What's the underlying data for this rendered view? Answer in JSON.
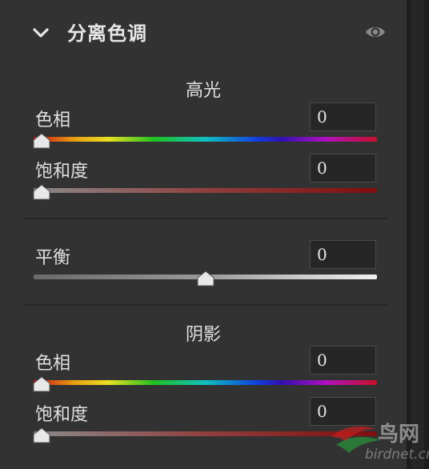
{
  "panel": {
    "title": "分离色调",
    "icons": {
      "collapse": "chevron-down-icon",
      "visibility": "eye-icon"
    }
  },
  "highlights": {
    "label": "高光",
    "hue": {
      "label": "色相",
      "value": "0",
      "slider_fraction": 0.0
    },
    "saturation": {
      "label": "饱和度",
      "value": "0",
      "slider_fraction": 0.0
    }
  },
  "balance": {
    "label": "平衡",
    "value": "0",
    "slider_fraction": 0.5
  },
  "shadows": {
    "label": "阴影",
    "hue": {
      "label": "色相",
      "value": "0",
      "slider_fraction": 0.0
    },
    "saturation": {
      "label": "饱和度",
      "value": "0",
      "slider_fraction": 0.0
    }
  },
  "watermark": {
    "name": "鸟网",
    "url": "birdnet.cn"
  },
  "colors": {
    "panel_bg": "#323232",
    "text": "#e0e0e0",
    "input_bg": "#262626",
    "divider": "#262626"
  }
}
